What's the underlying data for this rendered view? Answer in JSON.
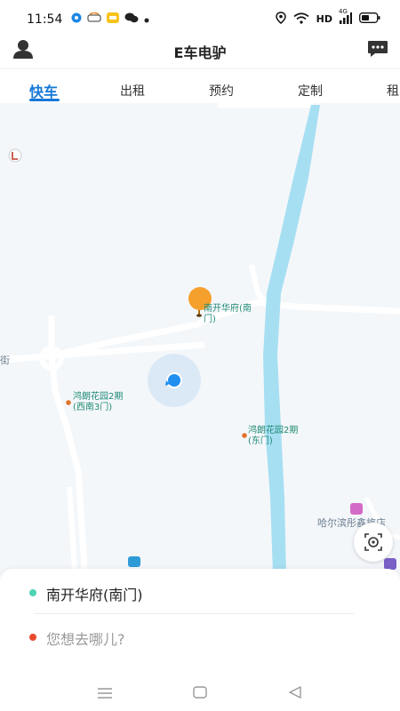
{
  "status_bar": {
    "time": "11:54",
    "network": "HD",
    "signal_type": "4G"
  },
  "header": {
    "title": "E车电驴"
  },
  "tabs": [
    {
      "label": "快车",
      "active": true
    },
    {
      "label": "出租",
      "active": false
    },
    {
      "label": "预约",
      "active": false
    },
    {
      "label": "定制",
      "active": false
    },
    {
      "label": "租",
      "active": false
    }
  ],
  "map": {
    "pin_label_line1": "南开华府(南",
    "pin_label_line2": "门)",
    "poi_1_line1": "鸿朗花园2期",
    "poi_1_line2": "(西南3门)",
    "poi_2_line1": "鸿朗花园2期",
    "poi_2_line2": "(东门)",
    "poi_3": "哈尔滨彤鑫旅店",
    "edge_text": "街"
  },
  "trip": {
    "pickup": "南开华府(南门)",
    "destination_placeholder": "您想去哪儿?",
    "pickup_dot_color": "#4fd3b4",
    "destination_dot_color": "#e84a2c"
  },
  "colors": {
    "accent": "#1578d8",
    "river": "#a7dff2"
  }
}
